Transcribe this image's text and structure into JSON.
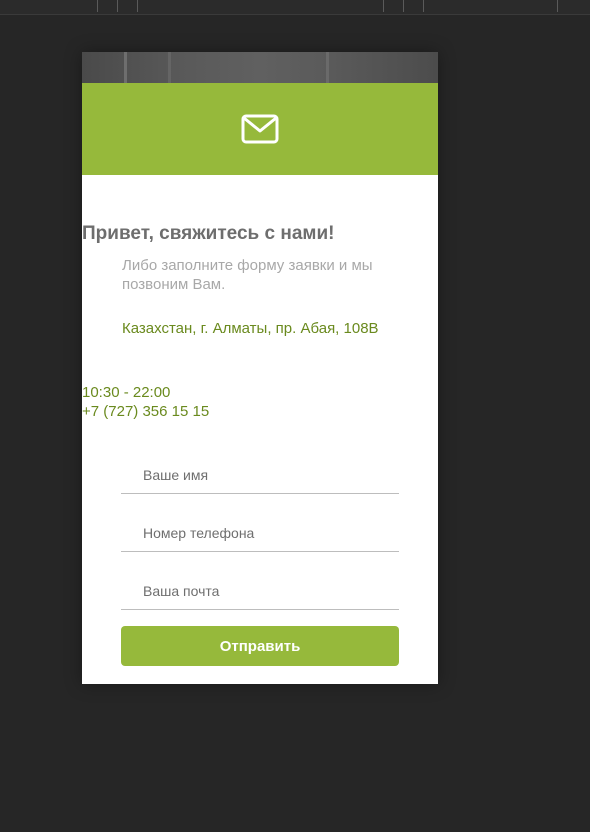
{
  "colors": {
    "background": "#262626",
    "accent": "#96b93b",
    "title": "#6e6e6e",
    "subtitle": "#a8a8a8",
    "contact": "#6a8a1e"
  },
  "header": {
    "icon": "envelope-icon"
  },
  "contact_form": {
    "title": "Привет, свяжитесь с нами!",
    "subtitle": "Либо заполните форму заявки и мы позвоним Вам.",
    "address": "Казахстан, г. Алматы, пр. Абая, 108В",
    "hours": "10:30 - 22:00",
    "phone": "+7 (727) 356 15 15",
    "fields": {
      "name_placeholder": "Ваше имя",
      "phone_placeholder": "Номер телефона",
      "email_placeholder": "Ваша почта"
    },
    "submit_label": "Отправить"
  }
}
